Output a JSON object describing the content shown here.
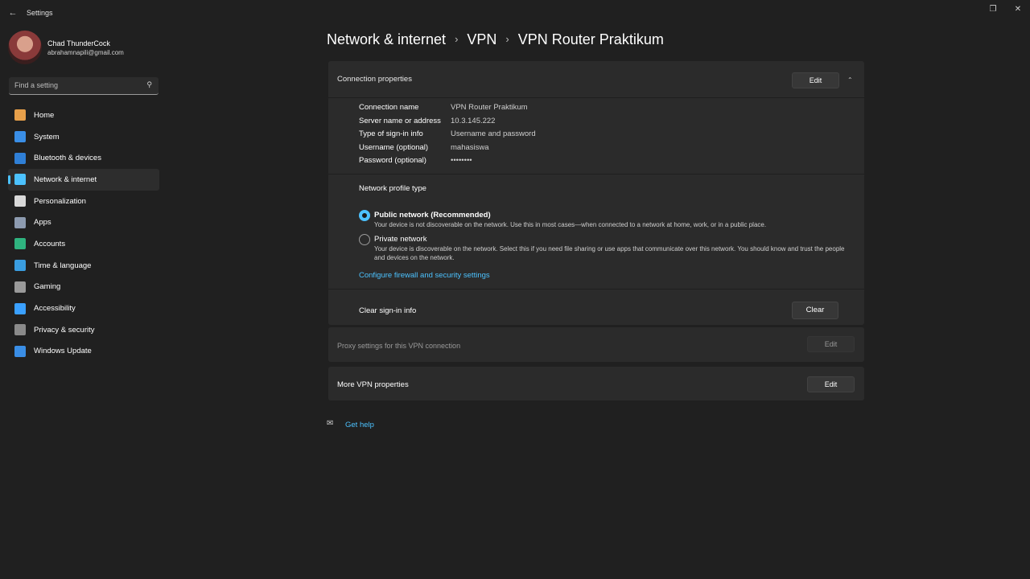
{
  "window": {
    "title": "Settings"
  },
  "profile": {
    "name": "Chad ThunderCock",
    "email": "abrahamnapili@gmail.com"
  },
  "search": {
    "placeholder": "Find a setting"
  },
  "nav": [
    {
      "label": "Home",
      "icon": "home-icon",
      "color": "#e8a04a"
    },
    {
      "label": "System",
      "icon": "system-icon",
      "color": "#3a8ee6"
    },
    {
      "label": "Bluetooth & devices",
      "icon": "bluetooth-icon",
      "color": "#2f7fd6"
    },
    {
      "label": "Network & internet",
      "icon": "network-icon",
      "color": "#4cc2ff",
      "active": true
    },
    {
      "label": "Personalization",
      "icon": "brush-icon",
      "color": "#d8d8d8"
    },
    {
      "label": "Apps",
      "icon": "apps-icon",
      "color": "#8d9bb0"
    },
    {
      "label": "Accounts",
      "icon": "accounts-icon",
      "color": "#2fb37f"
    },
    {
      "label": "Time & language",
      "icon": "globe-clock-icon",
      "color": "#3a9de0"
    },
    {
      "label": "Gaming",
      "icon": "gaming-icon",
      "color": "#9a9a9a"
    },
    {
      "label": "Accessibility",
      "icon": "accessibility-icon",
      "color": "#3aa0ff"
    },
    {
      "label": "Privacy & security",
      "icon": "shield-icon",
      "color": "#8a8a8a"
    },
    {
      "label": "Windows Update",
      "icon": "update-icon",
      "color": "#3a8ee6"
    }
  ],
  "breadcrumb": [
    "Network & internet",
    "VPN",
    "VPN Router Praktikum"
  ],
  "connection": {
    "header": "Connection properties",
    "edit_label": "Edit",
    "properties": [
      {
        "label": "Connection name",
        "value": "VPN Router Praktikum"
      },
      {
        "label": "Server name or address",
        "value": "10.3.145.222"
      },
      {
        "label": "Type of sign-in info",
        "value": "Username and password"
      },
      {
        "label": "Username (optional)",
        "value": "mahasiswa"
      },
      {
        "label": "Password (optional)",
        "value": "••••••••"
      }
    ],
    "profile_type_label": "Network profile type",
    "public": {
      "label": "Public network (Recommended)",
      "desc": "Your device is not discoverable on the network. Use this in most cases—when connected to a network at home, work, or in a public place."
    },
    "private": {
      "label": "Private network",
      "desc": "Your device is discoverable on the network. Select this if you need file sharing or use apps that communicate over this network. You should know and trust the people and devices on the network."
    },
    "firewall_link": "Configure firewall and security settings",
    "clear_label": "Clear sign-in info",
    "clear_button": "Clear"
  },
  "proxy": {
    "label": "Proxy settings for this VPN connection",
    "edit_label": "Edit"
  },
  "more": {
    "label": "More VPN properties",
    "edit_label": "Edit"
  },
  "help": {
    "label": "Get help"
  }
}
